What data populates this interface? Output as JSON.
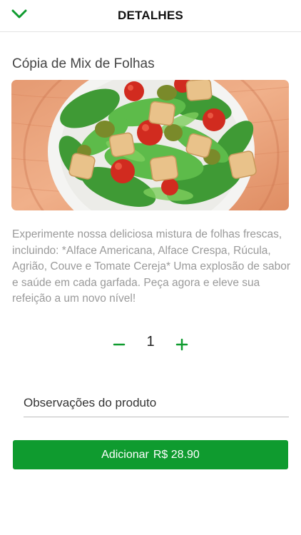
{
  "header": {
    "title": "DETALHES",
    "back_icon": "chevron-down-icon"
  },
  "product": {
    "name": "Cópia de Mix de Folhas",
    "description": "Experimente nossa deliciosa mistura de folhas frescas, incluindo: *Alface Americana, Alface Crespa, Rúcula, Agrião, Couve e Tomate Cereja* Uma explosão de sabor e saúde em cada garfada. Peça agora e eleve sua refeição a um novo nível!"
  },
  "quantity": {
    "minus_icon": "minus-icon",
    "value": "1",
    "plus_icon": "plus-icon"
  },
  "notes": {
    "placeholder": "Observações do produto",
    "value": ""
  },
  "add_button": {
    "label": "Adicionar",
    "price": "R$ 28.90"
  },
  "colors": {
    "accent": "#0f9b2f",
    "description_text": "#9a9a9a",
    "divider": "#e3e3e3"
  }
}
